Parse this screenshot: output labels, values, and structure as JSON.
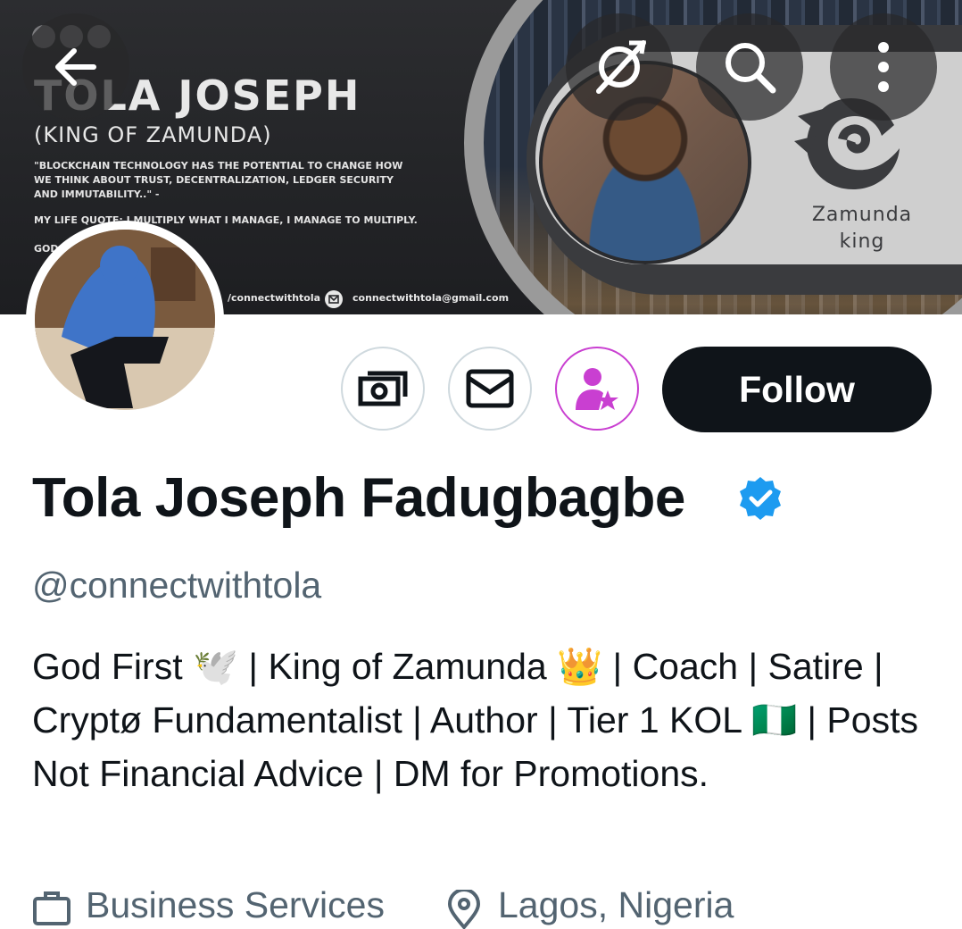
{
  "banner": {
    "title": "TOLA JOSEPH",
    "subtitle": "(KING OF ZAMUNDA)",
    "quote": "\"BLOCKCHAIN TECHNOLOGY HAS THE POTENTIAL TO CHANGE HOW WE THINK ABOUT TRUST, DECENTRALIZATION, LEDGER SECURITY AND IMMUTABILITY..\" -",
    "life_quote": "MY LIFE QUOTE: I MULTIPLY WHAT I MANAGE, I MANAGE TO MULTIPLY.",
    "god": "GOD",
    "contact_handle": "/connectwithtola",
    "contact_email": "connectwithtola@gmail.com",
    "logo_text": "Zamunda king"
  },
  "toolbar": {
    "back_icon": "arrow-left-icon",
    "grok_icon": "grok-icon",
    "search_icon": "search-icon",
    "more_icon": "more-vertical-icon"
  },
  "actions": {
    "tip_icon": "money-icon",
    "message_icon": "mail-icon",
    "subscribe_icon": "person-star-icon",
    "follow_label": "Follow",
    "subscribe_color": "#c93fd1"
  },
  "profile": {
    "name": "Tola Joseph Fadugbagbe",
    "verified_color": "#1d9bf0",
    "handle": "@connectwithtola",
    "bio": "God First 🕊️ | King of Zamunda 👑 | Coach | Satire | Cryptø Fundamentalist | Author | Tier 1 KOL 🇳🇬 | Posts Not Financial Advice | DM for Promotions.",
    "category": "Business Services",
    "location": "Lagos, Nigeria"
  }
}
